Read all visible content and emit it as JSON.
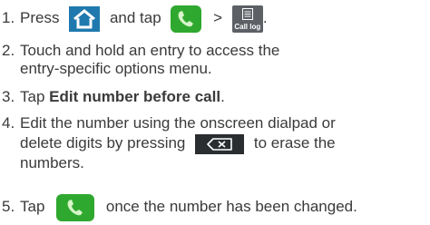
{
  "steps": [
    {
      "number": "1.",
      "text_press": "Press",
      "text_and_tap": "and tap",
      "text_gt": ">",
      "text_end": ".",
      "calllog_label": "Call log"
    },
    {
      "number": "2.",
      "line1": "Touch and hold an entry to access the",
      "line2": "entry-specific options menu."
    },
    {
      "number": "3.",
      "text_tap": "Tap",
      "bold": "Edit number before call",
      "text_end": "."
    },
    {
      "number": "4.",
      "line1": "Edit the number using the onscreen dialpad or",
      "line2_a": "delete digits by pressing",
      "line2_b": "to erase the",
      "line3": "numbers."
    },
    {
      "number": "5.",
      "text_tap": "Tap",
      "text_rest": "once the number has been changed."
    }
  ],
  "icons": {
    "home": "home-icon",
    "phone": "phone-icon",
    "call_log": "call-log-icon",
    "delete": "backspace-icon"
  },
  "colors": {
    "home_bg": "#1f79ae",
    "phone_bg": "#2fa82f",
    "calllog_bg": "#5d6166",
    "delete_bg": "#2b2e31",
    "text": "#3a3a3a"
  }
}
